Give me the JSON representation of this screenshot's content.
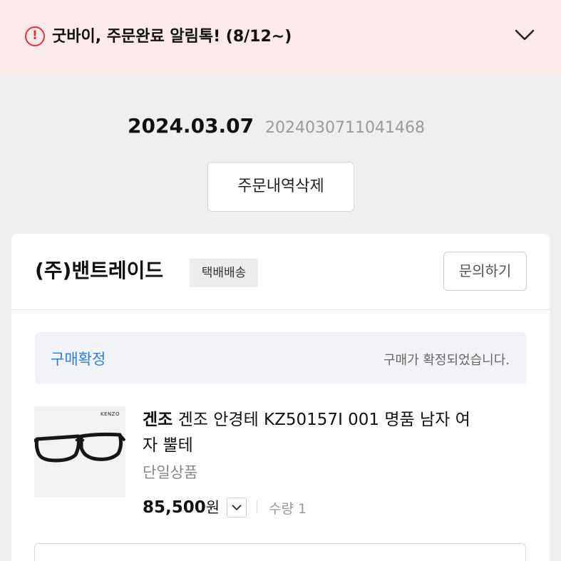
{
  "banner": {
    "alert_glyph": "!",
    "text": "굿바이, 주문완료 알림톡! (8/12~)",
    "icons": {
      "alert": "alert-circle-icon",
      "toggle": "chevron-down-icon"
    },
    "accent_color": "#e0323c",
    "background_color": "#fbeaea"
  },
  "order": {
    "date": "2024.03.07",
    "number": "2024030711041468",
    "delete_label": "주문내역삭제"
  },
  "seller": {
    "name": "(주)밴트레이드",
    "shipping_tag": "택배배송",
    "inquiry_label": "문의하기"
  },
  "status": {
    "label": "구매확정",
    "message": "구매가 확정되었습니다.",
    "color": "#2e7ed8"
  },
  "product": {
    "thumb_brand": "KENZO",
    "brand": "겐조",
    "title": " 겐조 안경테 KZ50157I 001 명품 남자 여자 뿔테",
    "option": "단일상품",
    "price": "85,500",
    "currency": "원",
    "quantity": "수량 1",
    "icons": {
      "price_toggle": "chevron-down-icon"
    }
  }
}
